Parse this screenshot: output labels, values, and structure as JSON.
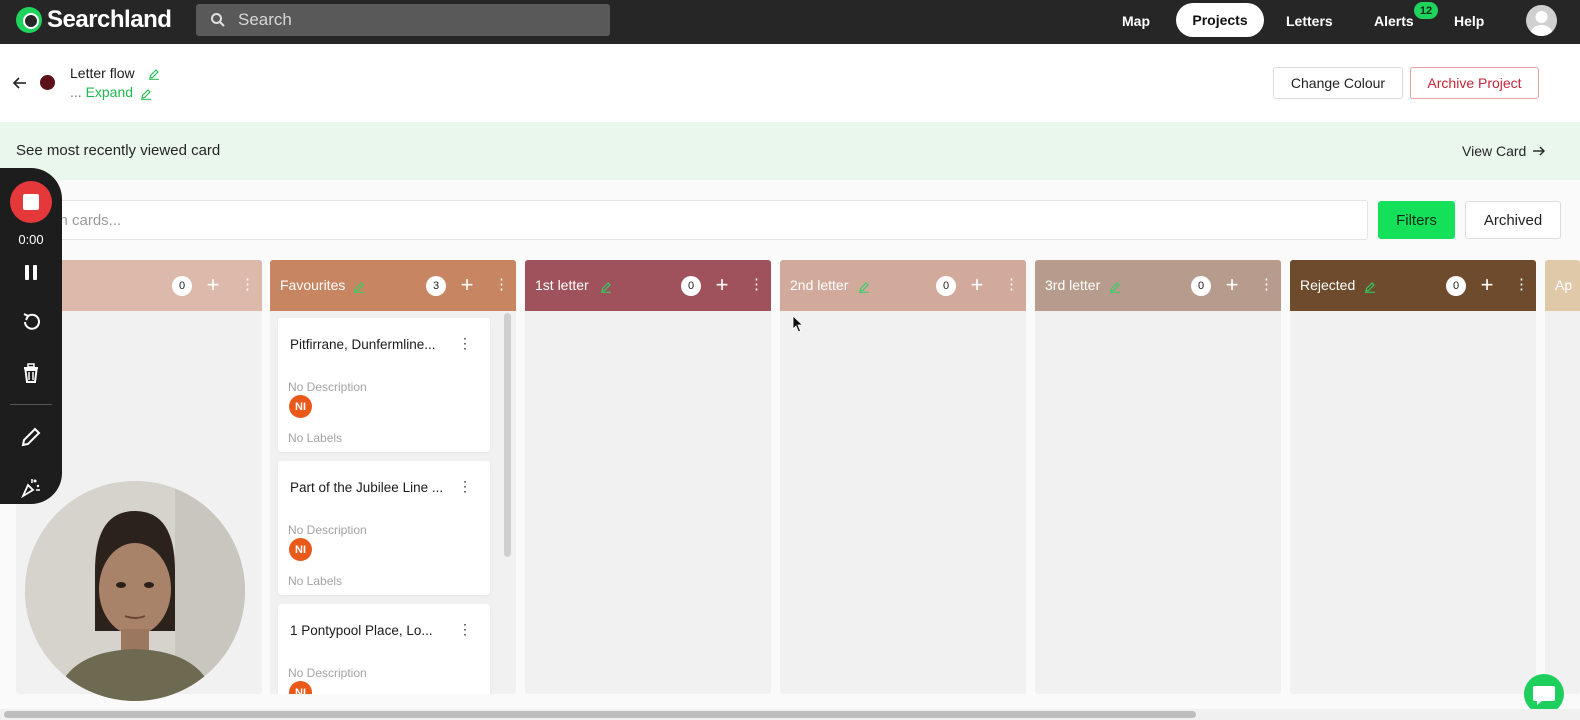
{
  "topnav": {
    "brand": "Searchland",
    "search_placeholder": "Search",
    "links": {
      "map": "Map",
      "projects": "Projects",
      "letters": "Letters",
      "alerts": "Alerts",
      "help": "Help"
    },
    "alerts_count": "12",
    "accent": "#1fd45d"
  },
  "project": {
    "title": "Letter flow",
    "expand_prefix": "...",
    "expand_label": "Expand",
    "dot_color": "#5c1018",
    "change_colour_label": "Change Colour",
    "archive_label": "Archive Project"
  },
  "banner": {
    "text": "See most recently viewed card",
    "link": "View Card"
  },
  "board": {
    "search_placeholder": "rch cards...",
    "filters_label": "Filters",
    "archived_label": "Archived",
    "columns": [
      {
        "title": "",
        "count": "0",
        "color": "#dcb9aa"
      },
      {
        "title": "Favourites",
        "count": "3",
        "color": "#c88561"
      },
      {
        "title": "1st letter",
        "count": "0",
        "color": "#a0525c"
      },
      {
        "title": "2nd letter",
        "count": "0",
        "color": "#d1aa9c"
      },
      {
        "title": "3rd letter",
        "count": "0",
        "color": "#b79b8c"
      },
      {
        "title": "Rejected",
        "count": "0",
        "color": "#6e4b2d"
      },
      {
        "title": "Ap",
        "count": "",
        "color": "#dfc9a8"
      }
    ],
    "cards": [
      {
        "title": "Pitfirrane, Dunfermline...",
        "description": "No Description",
        "avatar": "NI",
        "labels": "No Labels"
      },
      {
        "title": "Part of the Jubilee Line ...",
        "description": "No Description",
        "avatar": "NI",
        "labels": "No Labels"
      },
      {
        "title": "1 Pontypool Place, Lo...",
        "description": "No Description",
        "avatar": "NI",
        "labels": ""
      }
    ]
  },
  "recorder": {
    "time": "0:00"
  }
}
